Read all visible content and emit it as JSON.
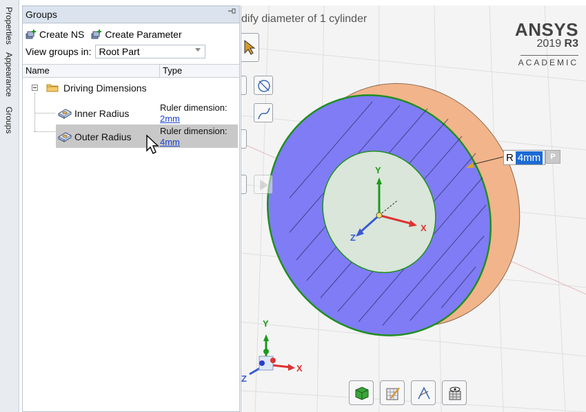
{
  "side_tabs": [
    "Properties",
    "Appearance",
    "Groups"
  ],
  "panel": {
    "title": "Groups",
    "pin_icon": "pin-icon",
    "toolbar": {
      "create_ns": "Create NS",
      "create_parameter": "Create Parameter"
    },
    "view_groups_label": "View groups in:",
    "view_groups_value": "Root Part",
    "columns": {
      "name": "Name",
      "type": "Type"
    },
    "tree": {
      "folder": "Driving Dimensions",
      "items": [
        {
          "name": "Inner Radius",
          "type_label": "Ruler dimension:",
          "type_value": "2mm"
        },
        {
          "name": "Outer Radius",
          "type_label": "Ruler dimension:",
          "type_value": "4mm"
        }
      ]
    }
  },
  "viewport": {
    "prompt": "dify diameter of 1 cylinder",
    "logo": {
      "brand": "ANSYS",
      "version": "2019",
      "release": "R3",
      "edition": "ACADEMIC"
    },
    "dimension": {
      "prefix": "R",
      "value": "4mm",
      "p_button": "P"
    },
    "axes": {
      "x": "X",
      "y": "Y",
      "z": "Z"
    },
    "triad": {
      "x": "X",
      "y": "Y",
      "z": "Z"
    }
  },
  "colors": {
    "ring_face": "#7f7cf5",
    "ring_side": "#f2b48a",
    "highlight_edge": "#1e8f1e",
    "selected_row": "#c8c8c8"
  }
}
